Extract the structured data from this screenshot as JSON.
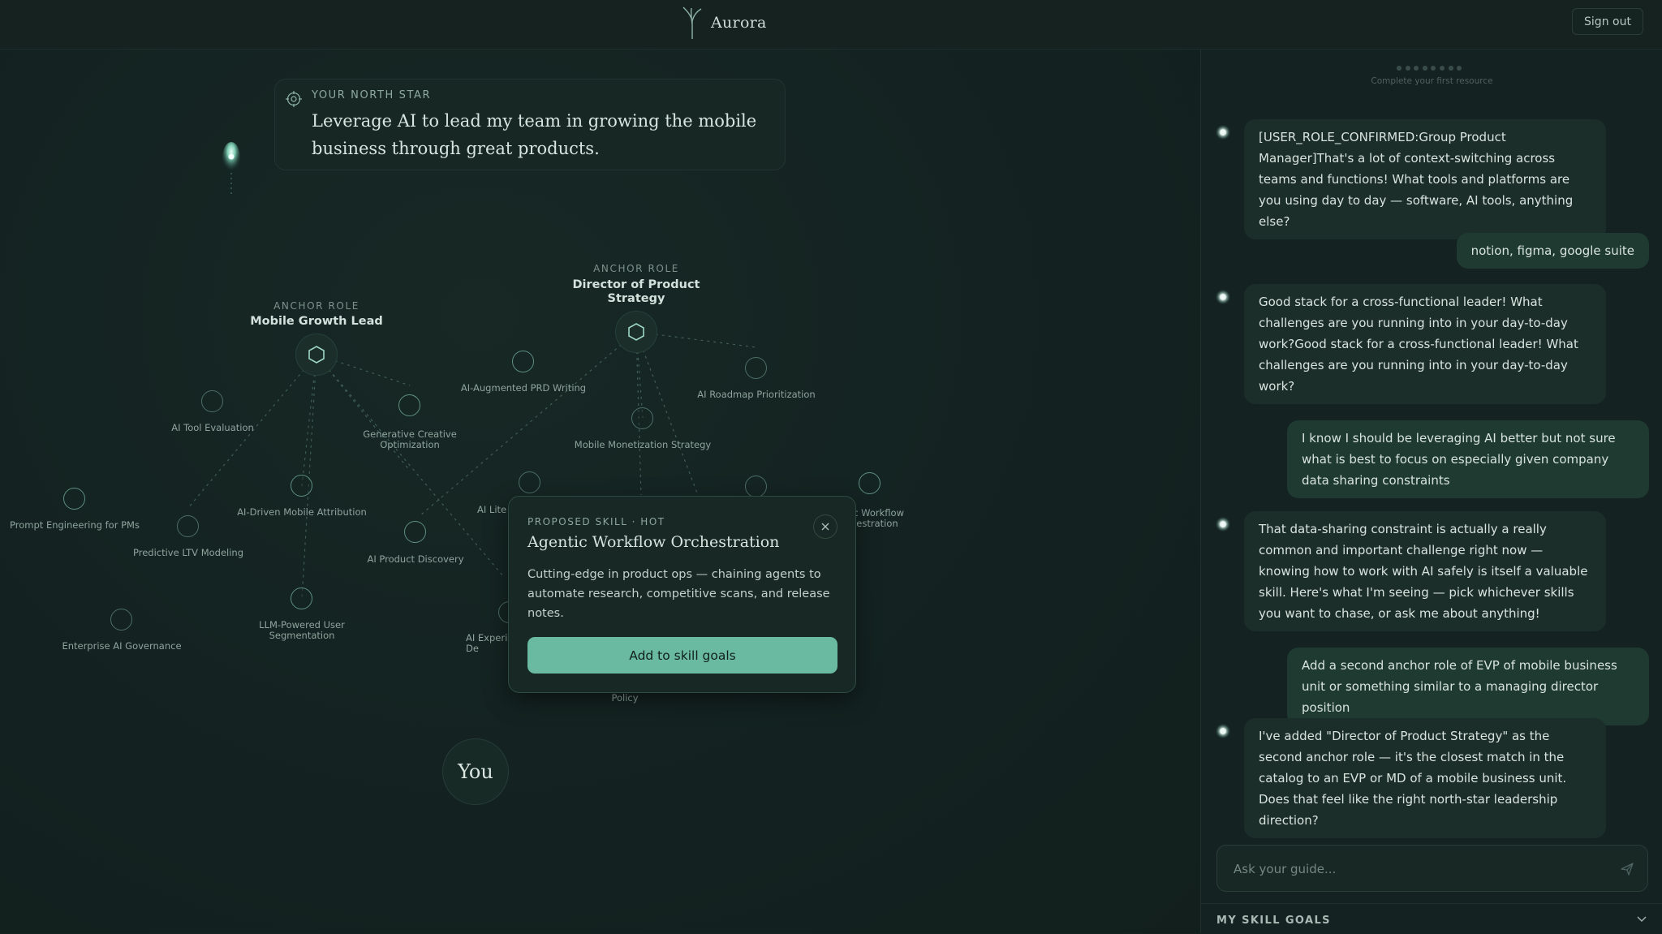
{
  "header": {
    "brand": "Aurora",
    "sign_out": "Sign out"
  },
  "north_star": {
    "label": "YOUR NORTH STAR",
    "text": "Leverage AI to lead my team in growing the mobile business through great products."
  },
  "anchors": [
    {
      "kicker": "ANCHOR ROLE",
      "name": "Mobile Growth Lead"
    },
    {
      "kicker": "ANCHOR ROLE",
      "name": "Director of Product Strategy"
    }
  ],
  "skills": [
    {
      "label": "AI Tool Evaluation"
    },
    {
      "label": "Generative Creative Optimization"
    },
    {
      "label": "AI-Augmented PRD Writing"
    },
    {
      "label": "AI Roadmap Prioritization"
    },
    {
      "label": "Mobile Monetization Strategy"
    },
    {
      "label": "Prompt Engineering for PMs"
    },
    {
      "label": "Predictive LTV Modeling"
    },
    {
      "label": "AI-Driven Mobile Attribution"
    },
    {
      "label": "AI Product Discovery"
    },
    {
      "label": "AI Lite"
    },
    {
      "label": "ic Workflow hestration"
    },
    {
      "label": "LLM-Powered User Segmentation"
    },
    {
      "label": "Enterprise AI Governance"
    },
    {
      "label": "AI Experi De"
    },
    {
      "label": "Policy"
    }
  ],
  "you_label": "You",
  "popup": {
    "kicker": "PROPOSED SKILL · HOT",
    "title": "Agentic Workflow Orchestration",
    "description": "Cutting-edge in product ops — chaining agents to automate research, competitive scans, and release notes.",
    "button": "Add to skill goals"
  },
  "chat": {
    "progress_caption": "Complete your first resource",
    "messages": [
      {
        "role": "ai",
        "text": "[USER_ROLE_CONFIRMED:Group Product Manager]That's a lot of context-switching across teams and functions! What tools and platforms are you using day to day — software, AI tools, anything else?"
      },
      {
        "role": "user",
        "text": "notion, figma, google suite"
      },
      {
        "role": "ai",
        "text": "Good stack for a cross-functional leader! What challenges are you running into in your day-to-day work?Good stack for a cross-functional leader! What challenges are you running into in your day-to-day work?"
      },
      {
        "role": "user",
        "text": "I know I should be leveraging AI better but not sure what is best to focus on especially given company data sharing constraints"
      },
      {
        "role": "ai",
        "text": "That data-sharing constraint is actually a really common and important challenge right now — knowing how to work with AI safely is itself a valuable skill. Here's what I'm seeing — pick whichever skills you want to chase, or ask me about anything!"
      },
      {
        "role": "user",
        "text": "Add a second anchor role of EVP of mobile business unit or something similar to a managing director position"
      },
      {
        "role": "ai",
        "text": "I've added \"Director of Product Strategy\" as the second anchor role — it's the closest match in the catalog to an EVP or MD of a mobile business unit. Does that feel like the right north-star leadership direction?"
      }
    ],
    "input_placeholder": "Ask your guide...",
    "skill_goals_title": "MY SKILL GOALS"
  }
}
